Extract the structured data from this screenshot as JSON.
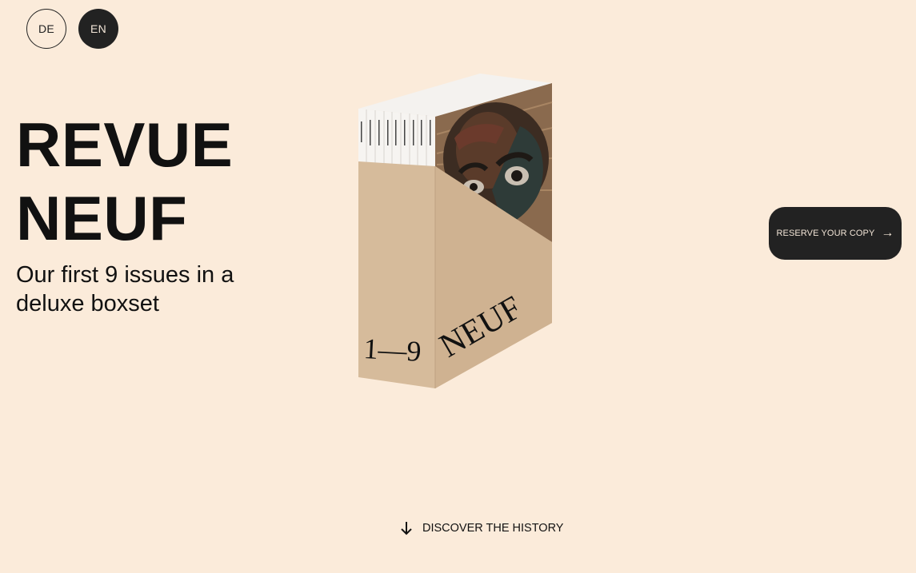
{
  "language_switch": {
    "items": [
      {
        "label": "DE",
        "active": false
      },
      {
        "label": "EN",
        "active": true
      }
    ]
  },
  "hero": {
    "title_line1": "REVUE",
    "title_line2": "NEUF",
    "subtitle": "Our first 9 issues in a deluxe boxset"
  },
  "product_image": {
    "front_text_numbers": "1—9",
    "front_text_name": "NEUF"
  },
  "cta": {
    "reserve_label": "RESERVE YOUR COPY",
    "reserve_icon": "arrow-right-icon"
  },
  "footer": {
    "discover_label": "DISCOVER THE HISTORY",
    "discover_icon": "arrow-down-icon"
  },
  "colors": {
    "background": "#fbebda",
    "dark": "#222222",
    "box": "#d4b797"
  }
}
